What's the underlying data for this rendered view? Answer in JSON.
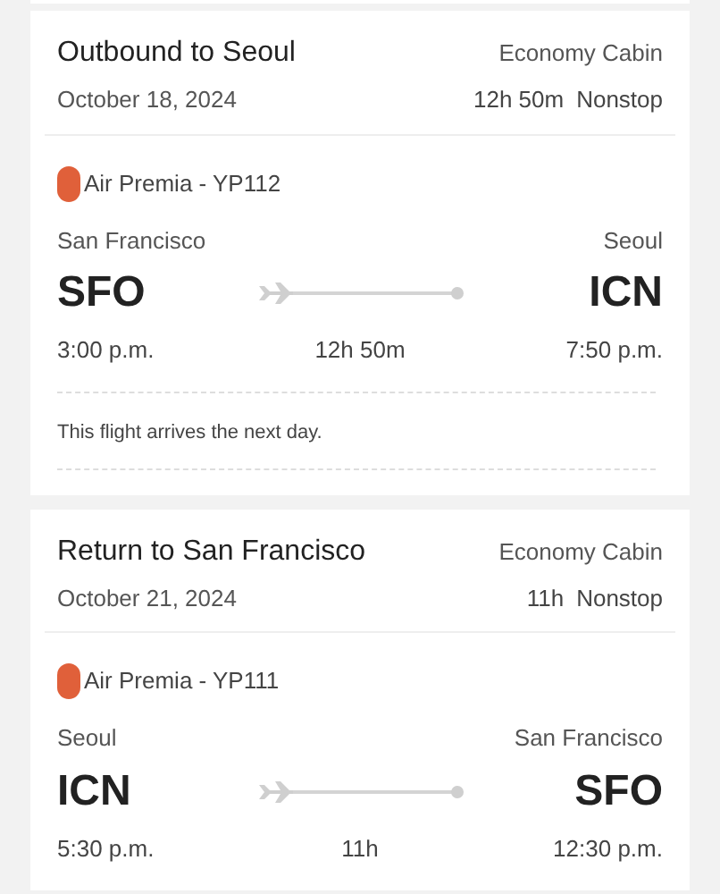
{
  "flights": [
    {
      "title": "Outbound to Seoul",
      "cabin": "Economy Cabin",
      "date": "October 18, 2024",
      "duration": "12h 50m",
      "stops": "Nonstop",
      "airline": "Air Premia - YP112",
      "from_city": "San Francisco",
      "from_code": "SFO",
      "from_time": "3:00 p.m.",
      "leg_duration": "12h 50m",
      "to_city": "Seoul",
      "to_code": "ICN",
      "to_time": "7:50 p.m.",
      "note": "This flight arrives the next day."
    },
    {
      "title": "Return to San Francisco",
      "cabin": "Economy Cabin",
      "date": "October 21, 2024",
      "duration": "11h",
      "stops": "Nonstop",
      "airline": "Air Premia - YP111",
      "from_city": "Seoul",
      "from_code": "ICN",
      "from_time": "5:30 p.m.",
      "leg_duration": "11h",
      "to_city": "San Francisco",
      "to_code": "SFO",
      "to_time": "12:30 p.m."
    }
  ]
}
